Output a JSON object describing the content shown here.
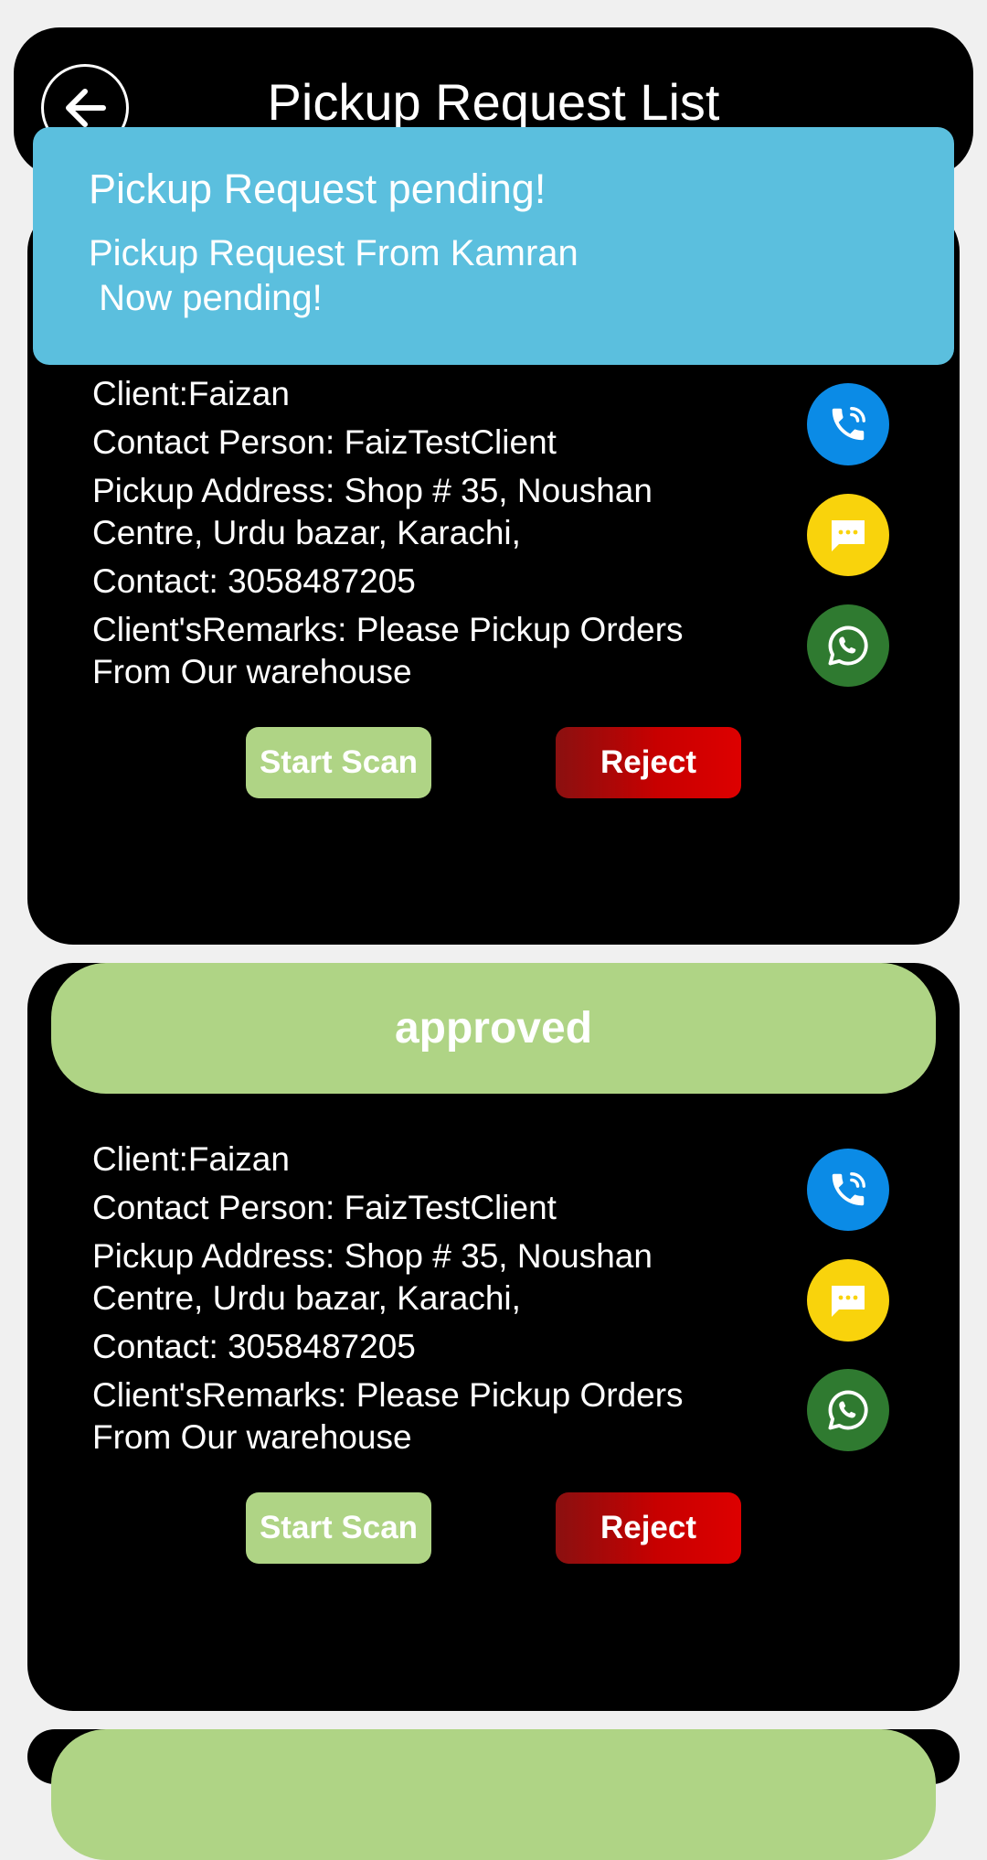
{
  "header": {
    "title": "Pickup Request List"
  },
  "toast": {
    "title": "Pickup Request pending!",
    "message": "Pickup Request From Kamran\n Now pending!"
  },
  "cards": [
    {
      "status": "",
      "client": "Client:Faizan",
      "contact_person": "Contact Person: FaizTestClient",
      "address": "Pickup Address: Shop # 35, Noushan Centre, Urdu bazar, Karachi,",
      "contact": "Contact: 3058487205",
      "remarks": "Client'sRemarks: Please Pickup Orders From Our warehouse",
      "scan_label": "Start Scan",
      "reject_label": "Reject"
    },
    {
      "status": "approved",
      "client": "Client:Faizan",
      "contact_person": "Contact Person: FaizTestClient",
      "address": "Pickup Address: Shop # 35, Noushan Centre, Urdu bazar, Karachi,",
      "contact": "Contact: 3058487205",
      "remarks": "Client'sRemarks: Please Pickup Orders From Our warehouse",
      "scan_label": "Start Scan",
      "reject_label": "Reject"
    }
  ],
  "icons": {
    "back": "arrow-left-icon",
    "call": "phone-icon",
    "sms": "message-icon",
    "whatsapp": "whatsapp-icon"
  },
  "colors": {
    "status_green": "#afd485",
    "call_blue": "#0b8be6",
    "sms_yellow": "#f9d30c",
    "whatsapp_green": "#2f7a30",
    "reject_red": "#dd0000",
    "toast_blue": "#5bbfde"
  }
}
